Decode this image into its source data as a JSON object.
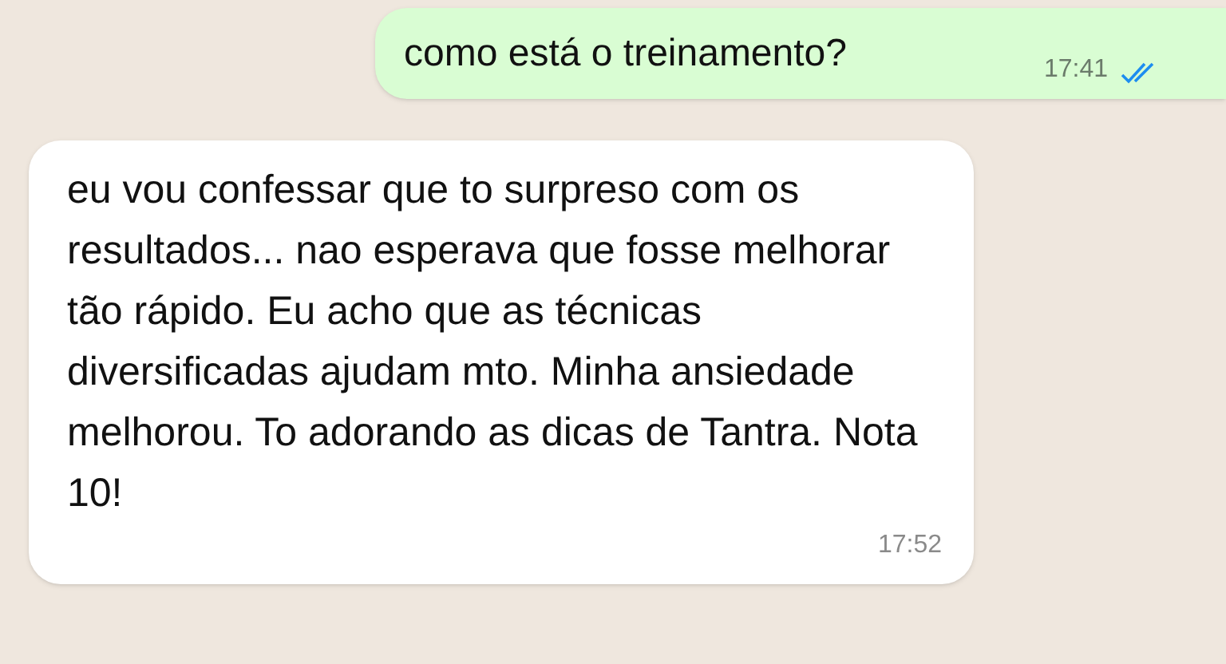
{
  "messages": [
    {
      "kind": "outgoing",
      "text": "como está o treinamento?",
      "time": "17:41",
      "read": true
    },
    {
      "kind": "incoming",
      "text": "eu vou confessar que to surpreso com os resultados... nao esperava que fosse melhorar tão rápido. Eu acho que as técnicas diversificadas ajudam mto. Minha ansiedade melhorou. To adorando as dicas de Tantra. Nota 10!",
      "time": "17:52"
    }
  ]
}
